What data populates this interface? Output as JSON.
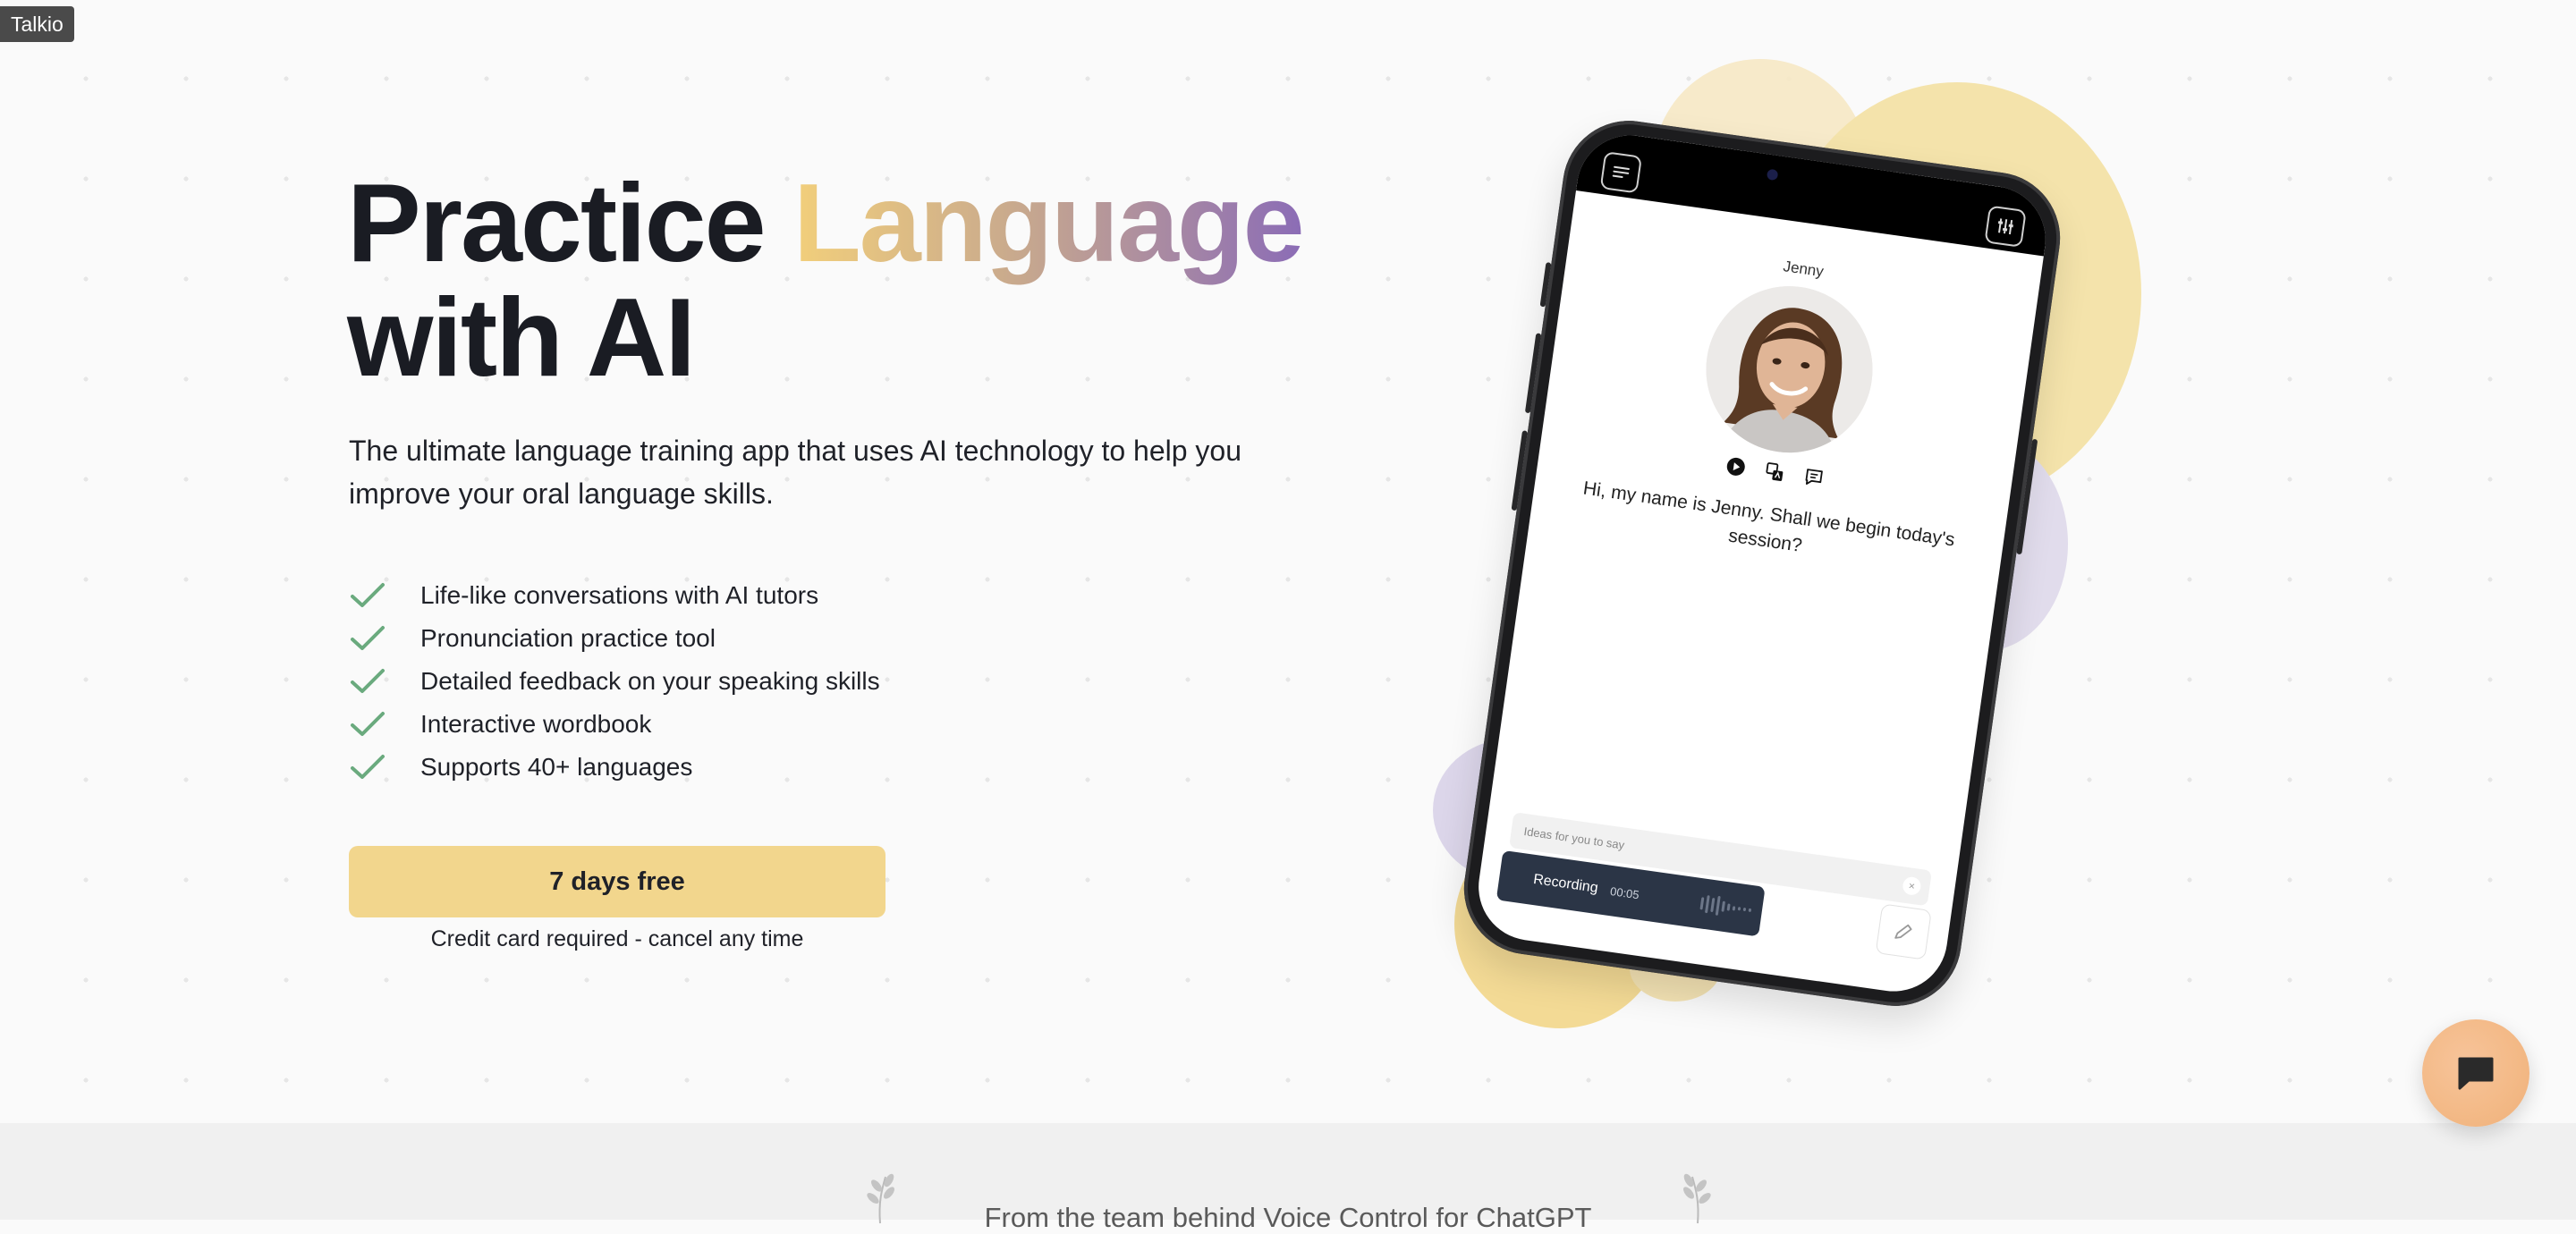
{
  "browser": {
    "tab_tooltip": "Talkio"
  },
  "hero": {
    "title_part1": "Practice ",
    "title_highlight": "Language",
    "title_part2": "with AI",
    "subtitle": "The ultimate language training app that uses AI technology to help you improve your oral language skills.",
    "features": [
      "Life-like conversations with AI tutors",
      "Pronunciation practice tool",
      "Detailed feedback on your speaking skills",
      "Interactive wordbook",
      "Supports 40+ languages"
    ],
    "cta_label": "7 days free",
    "cta_note": "Credit card required - cancel any time"
  },
  "phone": {
    "tutor_name": "Jenny",
    "message": "Hi, my name is Jenny. Shall we begin today's session?",
    "ideas_placeholder": "Ideas for you to say",
    "recording_label": "Recording",
    "recording_time": "00:05"
  },
  "footer_band": {
    "text": "From the team behind Voice Control for ChatGPT"
  },
  "colors": {
    "accent_yellow": "#f2d68d",
    "check_green": "#6aaa7e",
    "purple": "#8b6cb6",
    "chat_fab": "#f3b986"
  },
  "icons": {
    "feature_bullet": "check-icon",
    "phone_menu": "menu-icon",
    "phone_settings": "sliders-icon",
    "chat_fab": "chat-bubble-icon"
  }
}
